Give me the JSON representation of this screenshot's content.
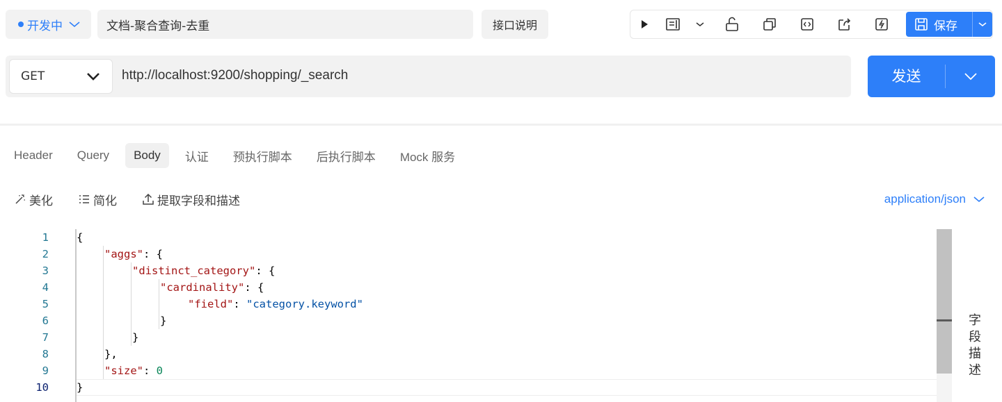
{
  "topbar": {
    "status": "开发中",
    "api_name": "文档-聚合查询-去重",
    "doc_button": "接口说明",
    "save_label": "保存"
  },
  "request": {
    "method": "GET",
    "url": "http://localhost:9200/shopping/_search",
    "send_label": "发送"
  },
  "tabs": [
    {
      "label": "Header",
      "active": false
    },
    {
      "label": "Query",
      "active": false
    },
    {
      "label": "Body",
      "active": true
    },
    {
      "label": "认证",
      "active": false
    },
    {
      "label": "预执行脚本",
      "active": false
    },
    {
      "label": "后执行脚本",
      "active": false
    },
    {
      "label": "Mock 服务",
      "active": false
    }
  ],
  "editor_tools": {
    "beautify": "美化",
    "simplify": "简化",
    "extract": "提取字段和描述",
    "content_type": "application/json"
  },
  "code": {
    "line_numbers": [
      "1",
      "2",
      "3",
      "4",
      "5",
      "6",
      "7",
      "8",
      "9",
      "10"
    ],
    "current_line": 10,
    "keys": [
      "\"aggs\"",
      "\"distinct_category\"",
      "\"cardinality\"",
      "\"field\"",
      "\"size\""
    ],
    "field_value": "\"category.keyword\"",
    "size_value": "0"
  },
  "side_panel": {
    "chars": [
      "字",
      "段",
      "描",
      "述"
    ]
  },
  "colors": {
    "accent": "#2d7ff9",
    "json_key": "#a31515",
    "json_string": "#0451a5",
    "json_number": "#098658",
    "line_number": "#237893"
  }
}
